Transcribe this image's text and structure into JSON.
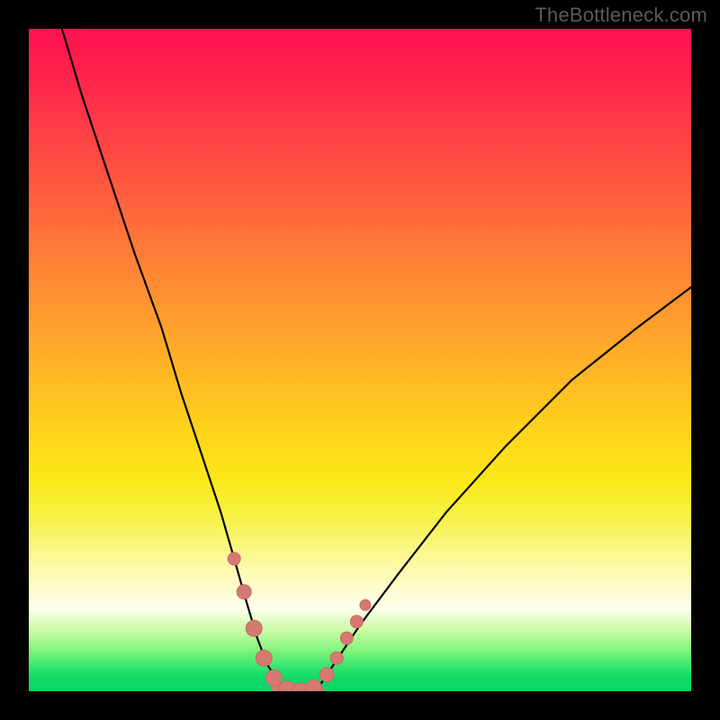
{
  "watermark": "TheBottleneck.com",
  "chart_data": {
    "type": "line",
    "title": "",
    "xlabel": "",
    "ylabel": "",
    "xlim": [
      0,
      100
    ],
    "ylim": [
      0,
      100
    ],
    "grid": false,
    "legend": false,
    "background": {
      "kind": "vertical-gradient",
      "stops": [
        {
          "pos": 0,
          "color": "#ff134f"
        },
        {
          "pos": 24,
          "color": "#ff5a3f"
        },
        {
          "pos": 54,
          "color": "#ffbd23"
        },
        {
          "pos": 74,
          "color": "#f7f24a"
        },
        {
          "pos": 90,
          "color": "#c7fba2"
        },
        {
          "pos": 100,
          "color": "#09d566"
        }
      ]
    },
    "series": [
      {
        "name": "bottleneck-curve",
        "x": [
          5,
          8,
          12,
          16,
          20,
          23,
          26,
          29,
          31,
          33,
          34.5,
          36,
          38,
          40,
          42,
          44,
          46,
          50,
          56,
          63,
          72,
          82,
          92,
          100
        ],
        "y": [
          100,
          90,
          78,
          66,
          55,
          45,
          36,
          27,
          20,
          13,
          8,
          4,
          1,
          0,
          0,
          1,
          4,
          10,
          18,
          27,
          37,
          47,
          55,
          61
        ]
      }
    ],
    "markers": [
      {
        "x": 31.0,
        "y": 20.0,
        "r": 7
      },
      {
        "x": 32.5,
        "y": 15.0,
        "r": 8
      },
      {
        "x": 34.0,
        "y": 9.5,
        "r": 9
      },
      {
        "x": 35.5,
        "y": 5.0,
        "r": 9
      },
      {
        "x": 37.0,
        "y": 2.0,
        "r": 9
      },
      {
        "x": 39.0,
        "y": 0.3,
        "r": 9
      },
      {
        "x": 41.0,
        "y": 0.0,
        "r": 9
      },
      {
        "x": 43.0,
        "y": 0.5,
        "r": 9
      },
      {
        "x": 45.0,
        "y": 2.5,
        "r": 8
      },
      {
        "x": 46.5,
        "y": 5.0,
        "r": 7
      },
      {
        "x": 48.0,
        "y": 8.0,
        "r": 7
      },
      {
        "x": 49.5,
        "y": 10.5,
        "r": 7
      },
      {
        "x": 50.8,
        "y": 13.0,
        "r": 6
      }
    ],
    "floor_segment": {
      "x0": 37.5,
      "x1": 43.5,
      "y": 0.2
    }
  }
}
